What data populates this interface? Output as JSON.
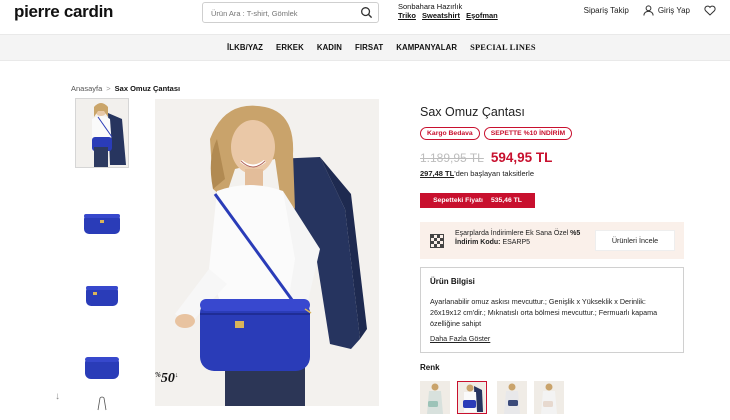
{
  "header": {
    "logo": "pierre cardin",
    "search_placeholder": "Ürün Ara : T-shirt, Gömlek",
    "promo_line1": "Sonbahara Hazırlık",
    "promo_links": [
      "Triko",
      "Sweatshirt",
      "Eşofman"
    ],
    "order_track": "Sipariş Takip",
    "login": "Giriş Yap"
  },
  "nav": {
    "items": [
      "İLKB/YAZ",
      "ERKEK",
      "KADIN",
      "FIRSAT",
      "KAMPANYALAR",
      "SPECIAL LINES"
    ]
  },
  "breadcrumb": {
    "home": "Anasayfa",
    "separator": ">",
    "current": "Sax Omuz Çantası"
  },
  "product": {
    "title": "Sax Omuz Çantası",
    "tags": [
      "Kargo Bedava",
      "SEPETTE %10 İNDİRİM"
    ],
    "old_price": "1.189,95 TL",
    "new_price": "594,95 TL",
    "installment_amount": "297,48 TL",
    "installment_text": "'den başlayan taksitlerle",
    "cart_price_label": "Sepetteki Fiyatı",
    "cart_price_value": "535,46 TL",
    "image_badge_pct": "%",
    "image_badge_num": "50",
    "image_badge_arrow": "↓"
  },
  "promo_box": {
    "text_prefix": "Eşarplarda İndirimlere Ek Sana Özel ",
    "text_bold": "%5",
    "text_line2_bold": "İndirim Kodu:",
    "text_code": " ESARP5",
    "button": "Ürünleri İncele"
  },
  "info": {
    "heading": "Ürün Bilgisi",
    "body": "Ayarlanabilir omuz askısı mevcuttur.; Genişlik x Yükseklik x Derinlik: 26x19x12 cm'dir.; Mıknatıslı orta bölmesi mevcuttur.; Fermuarlı kapama özelliğine sahipt",
    "more": "Daha Fazla Göster"
  },
  "colors": {
    "label": "Renk",
    "swatch_count": 4,
    "selected_index": 1
  },
  "theme": {
    "accent": "#c8102e",
    "bag_blue": "#2a3cb8",
    "nav_bg": "#f4f4f4",
    "promo_bg": "#faf0ea"
  }
}
